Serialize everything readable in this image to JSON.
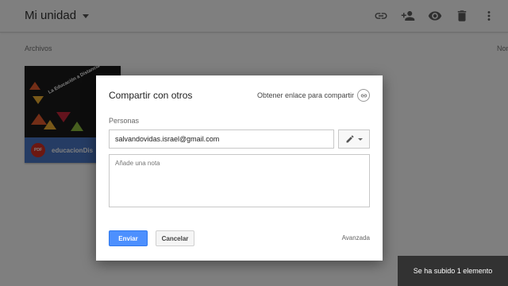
{
  "header": {
    "title": "Mi unidad",
    "icons": [
      "link-icon",
      "add-person-icon",
      "eye-icon",
      "trash-icon",
      "more-vert-icon"
    ]
  },
  "main": {
    "section_label": "Archivos",
    "column_label": "Nom",
    "file": {
      "name": "educacionDis",
      "type_badge": "PDF",
      "thumbnail_title": "La Educación a Distancia en"
    }
  },
  "dialog": {
    "title": "Compartir con otros",
    "get_link_label": "Obtener enlace para compartir",
    "people_label": "Personas",
    "email_value": "salvandovidas.israel@gmail.com",
    "note_placeholder": "Añade una nota",
    "send_label": "Enviar",
    "cancel_label": "Cancelar",
    "advanced_label": "Avanzada"
  },
  "toast": {
    "message": "Se ha subido 1 elemento"
  },
  "colors": {
    "accent_blue": "#4d90fe",
    "file_footer": "#4a78c9",
    "pdf_red": "#d93025",
    "toast_bg": "#323232"
  }
}
